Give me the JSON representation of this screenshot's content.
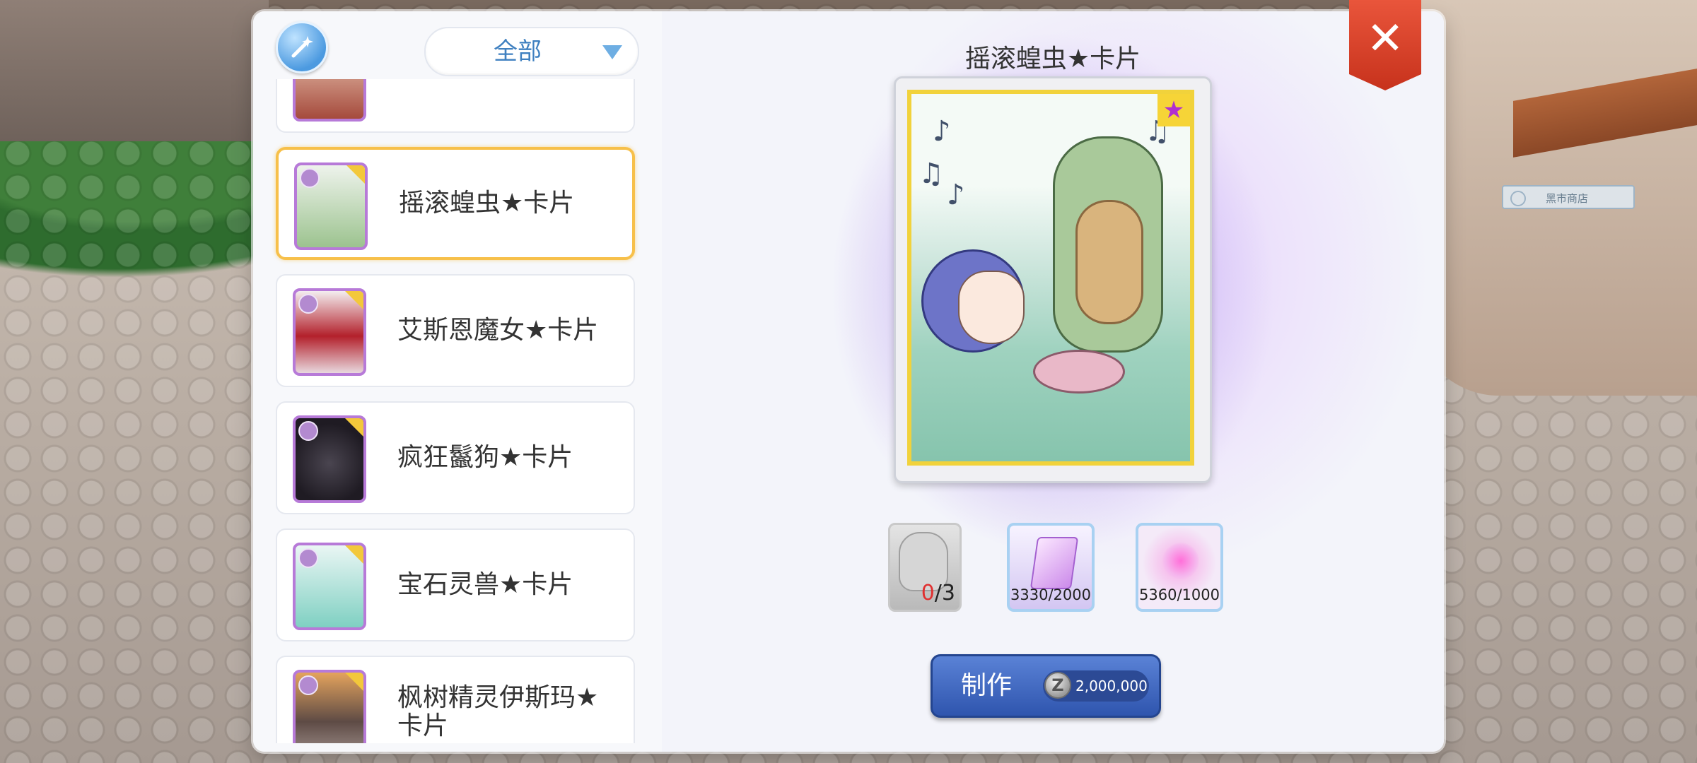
{
  "filter": {
    "label": "全部"
  },
  "list": {
    "items": [
      {
        "name": ""
      },
      {
        "name": "摇滚蝗虫★卡片"
      },
      {
        "name": "艾斯恩魔女★卡片"
      },
      {
        "name": "疯狂鬣狗★卡片"
      },
      {
        "name": "宝石灵兽★卡片"
      },
      {
        "name": "枫树精灵伊斯玛★卡片"
      }
    ]
  },
  "detail": {
    "title": "摇滚蝗虫★卡片",
    "materials": [
      {
        "have": "0",
        "need": "/3"
      },
      {
        "count": "3330/2000"
      },
      {
        "count": "5360/1000"
      }
    ],
    "craft_label": "制作",
    "price": "2,000,000",
    "zeny_symbol": "Z"
  },
  "background": {
    "shop_sign": "黑市商店"
  },
  "colors": {
    "selected_border": "#f7c04a",
    "accent_blue": "#3f80c0",
    "close_red": "#d9432a"
  }
}
